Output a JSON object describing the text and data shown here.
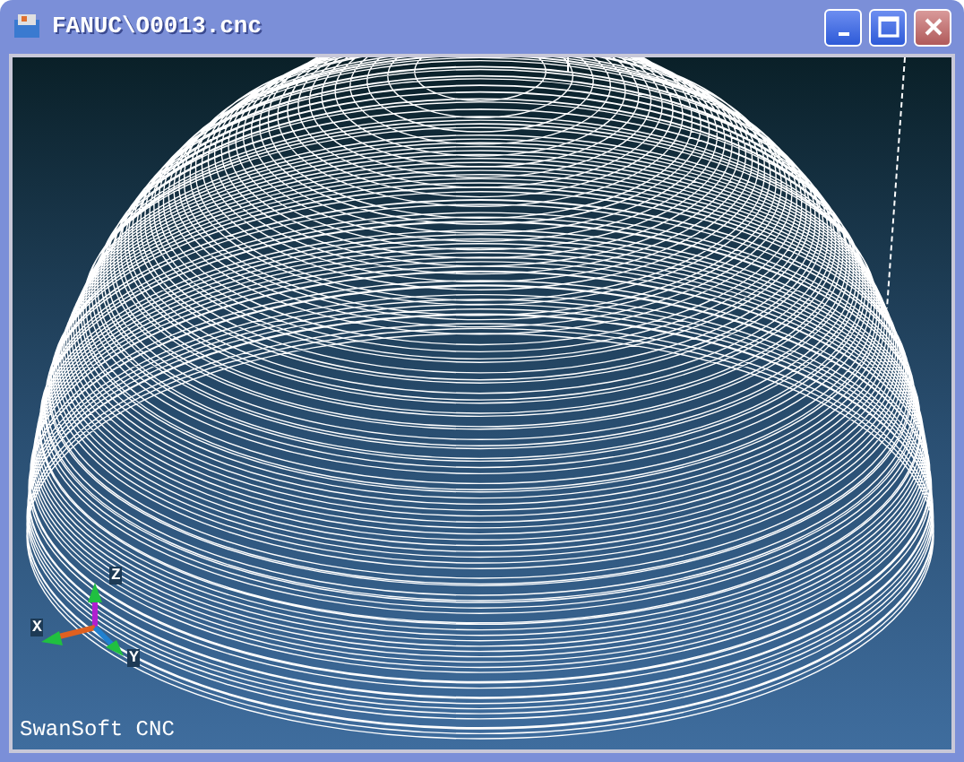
{
  "window": {
    "title": "FANUC\\O0013.cnc"
  },
  "viewport": {
    "axes": [
      {
        "kind": "z",
        "label": "Z"
      },
      {
        "kind": "x",
        "label": "X"
      },
      {
        "kind": "y",
        "label": "Y"
      }
    ],
    "caption": "SwanSoft CNC"
  }
}
